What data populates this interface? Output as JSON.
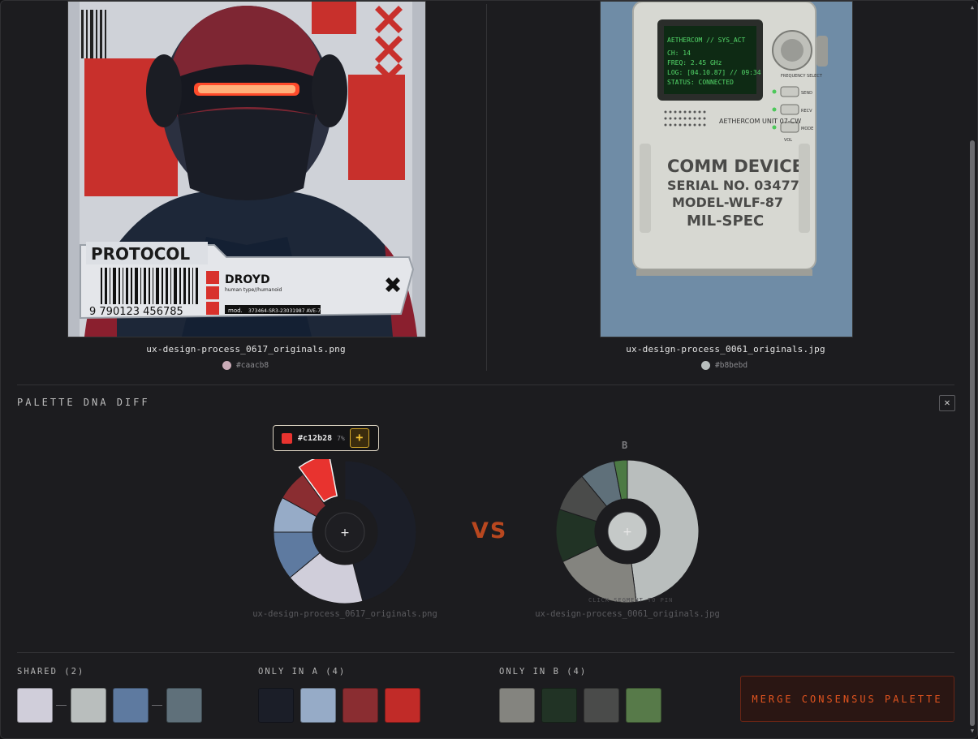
{
  "images": [
    {
      "filename": "ux-design-process_0617_originals.png",
      "hex": "#caacb8",
      "color": "#caacb8",
      "art": {
        "brand": "PROTOCOL",
        "name": "DROYD",
        "type": "human type//humanoid",
        "barcode": "9  790123  456785",
        "mod": "mod.",
        "serial": "373464-SR3-23031987 AVE-7"
      }
    },
    {
      "filename": "ux-design-process_0061_originals.jpg",
      "hex": "#b8bebd",
      "color": "#b8bebd",
      "art": {
        "screen": [
          "AETHERCOM // SYS_ACT",
          "CH: 14",
          "FREQ: 2.45 GHz",
          "LOG: [04.10.87] // 09:34",
          "STATUS: CONNECTED"
        ],
        "brand_small": "AETHERCOM UNIT 07-CW",
        "buttons": [
          "SEND",
          "RECV",
          "MODE"
        ],
        "knob": "FREQUENCY SELECT",
        "vol": "VOL",
        "stencil": [
          "COMM DEVICE",
          "SERIAL NO. 03477",
          "MODEL-WLF-87",
          "MIL-SPEC"
        ]
      }
    }
  ],
  "section": {
    "title": "PALETTE DNA DIFF",
    "close_icon": "close-icon"
  },
  "tooltip": {
    "hex": "#c12b28",
    "pct": "7%",
    "add": "+",
    "color": "#e8332f"
  },
  "vs": "VS",
  "donut_a": {
    "center": "+",
    "file": "ux-design-process_0617_originals.png",
    "segments": [
      {
        "color": "#1b1e28",
        "fraction": 0.46
      },
      {
        "color": "#d0ceda",
        "fraction": 0.18
      },
      {
        "color": "#5e7aa0",
        "fraction": 0.11
      },
      {
        "color": "#96abc7",
        "fraction": 0.08
      },
      {
        "color": "#8a2d31",
        "fraction": 0.07
      },
      {
        "color": "#e8332f",
        "fraction": 0.07,
        "pinned": true
      }
    ]
  },
  "donut_b": {
    "label": "B",
    "center": "+",
    "file": "ux-design-process_0061_originals.jpg",
    "hint": "CLICK SEGMENT TO PIN",
    "segments": [
      {
        "color": "#b9bebd",
        "fraction": 0.48
      },
      {
        "color": "#84847f",
        "fraction": 0.2
      },
      {
        "color": "#213325",
        "fraction": 0.12
      },
      {
        "color": "#4a4b4a",
        "fraction": 0.09
      },
      {
        "color": "#5f707a",
        "fraction": 0.08
      },
      {
        "color": "#4c7a44",
        "fraction": 0.03
      }
    ]
  },
  "groups": {
    "shared": {
      "title": "SHARED (2)",
      "swatches": [
        "#d0ceda",
        "#b9bebd",
        "#5e7aa0",
        "#5f707a"
      ]
    },
    "only_a": {
      "title": "ONLY IN A (4)",
      "swatches": [
        "#1b1e28",
        "#96abc7",
        "#8a2d31",
        "#c12b28"
      ]
    },
    "only_b": {
      "title": "ONLY IN B (4)",
      "swatches": [
        "#84847f",
        "#213325",
        "#4a4b4a",
        "#577a49"
      ]
    }
  },
  "merge": "MERGE CONSENSUS PALETTE"
}
